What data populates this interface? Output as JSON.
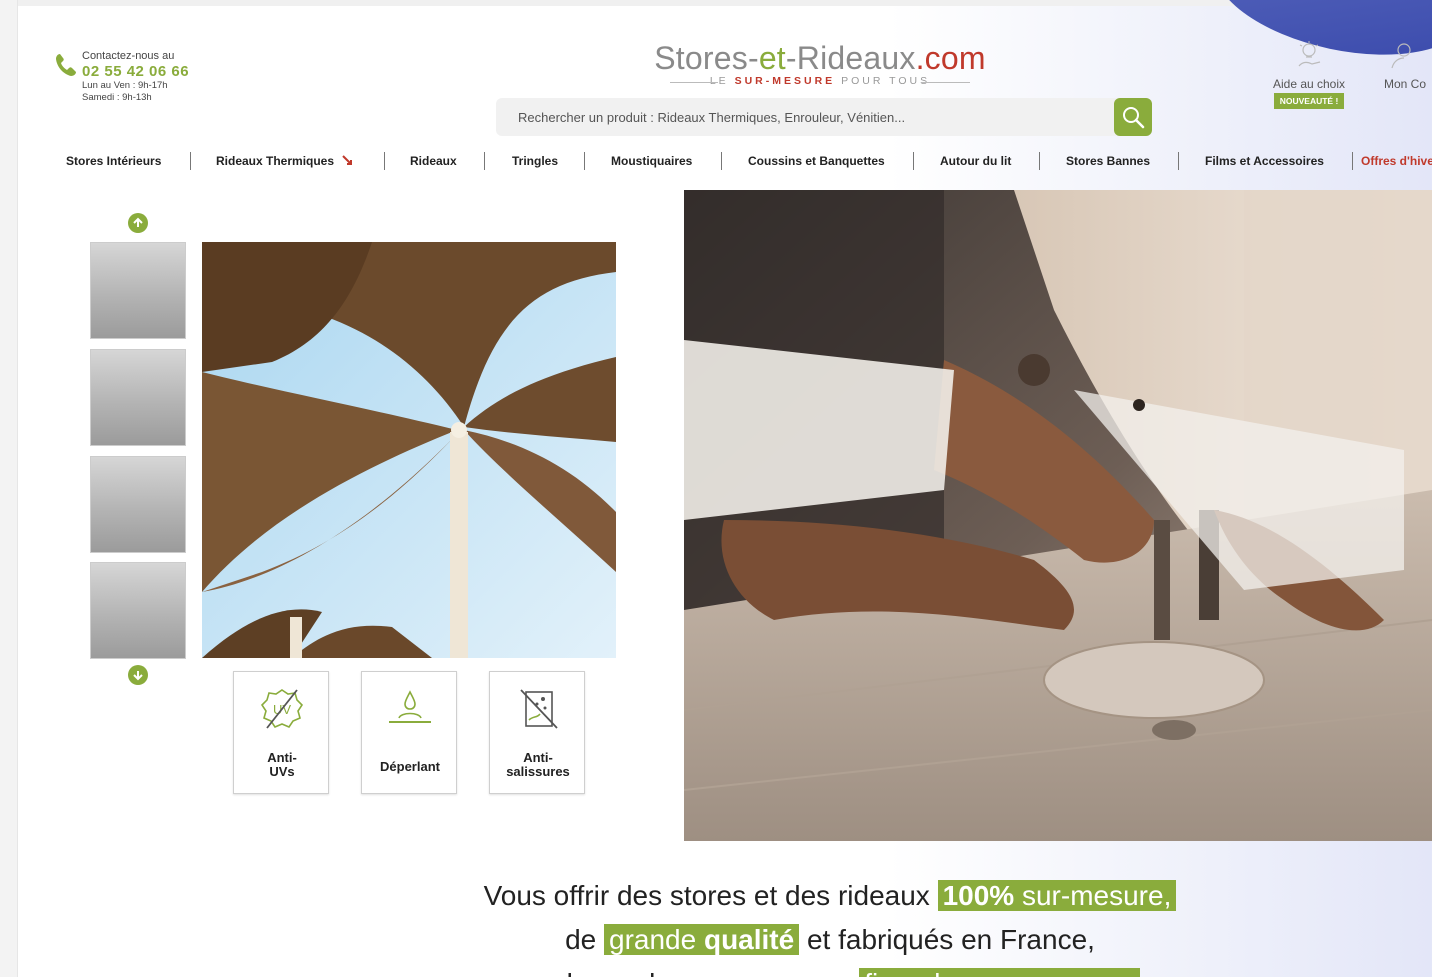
{
  "contact": {
    "intro": "Contactez-nous au",
    "phone": "02 55 42 06 66",
    "hours_week": "Lun au Ven : 9h-17h",
    "hours_sat": "Samedi : 9h-13h"
  },
  "logo": {
    "part1": "Stores-",
    "part2": "et",
    "part3": "-Rideaux",
    "part4": ".com",
    "tag_pre": "LE ",
    "tag_red": "SUR-MESURE",
    "tag_post": " POUR TOUS"
  },
  "search": {
    "placeholder": "Rechercher un produit : Rideaux Thermiques, Enrouleur, Vénitien..."
  },
  "header_links": {
    "help_label": "Aide au choix",
    "help_badge": "NOUVEAUTÉ !",
    "account_label": "Mon Co"
  },
  "nav": {
    "items": [
      "Stores Intérieurs",
      "Rideaux Thermiques",
      "Rideaux",
      "Tringles",
      "Moustiquaires",
      "Coussins et Banquettes",
      "Autour du lit",
      "Stores Bannes",
      "Films et Accessoires",
      "Offres d'hive"
    ]
  },
  "features": [
    {
      "line1": "Anti-",
      "line2": "UVs",
      "icon": "anti-uv-icon"
    },
    {
      "line1": "Déperlant",
      "line2": "",
      "icon": "water-repellent-icon"
    },
    {
      "line1": "Anti-",
      "line2": "salissures",
      "icon": "anti-stain-icon"
    }
  ],
  "tagline": {
    "l1_pre": "Vous offrir des stores et des rideaux ",
    "l1_hl_bold": "100%",
    "l1_hl_rest": " sur-mesure,",
    "l2_pre": "de ",
    "l2_hl_a": "grande ",
    "l2_hl_bold": "qualité",
    "l2_post": " et fabriqués en France,",
    "l3_pre": "sur lesquels nous sommes ",
    "l3_hl": "fiers de nous engager"
  },
  "colors": {
    "accent": "#8aac3c",
    "red": "#c0392b"
  }
}
